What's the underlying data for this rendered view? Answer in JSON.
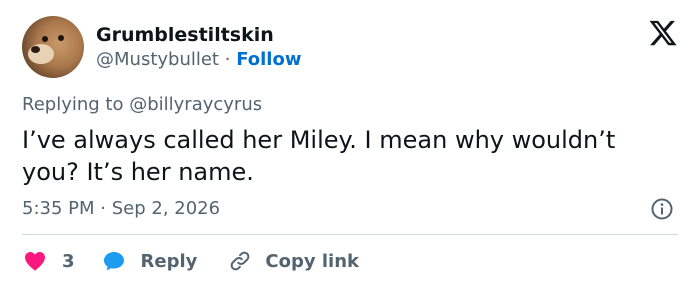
{
  "author": {
    "display_name": "Grumblestiltskin",
    "handle": "@Mustybullet",
    "separator": "·",
    "follow_label": "Follow"
  },
  "reply": {
    "prefix": "Replying to",
    "target": "@billyraycyrus"
  },
  "tweet": {
    "text": "I’ve always called her Miley. I mean why wouldn’t you? It’s her name.",
    "time": "5:35 PM",
    "separator": "·",
    "date": "Sep 2, 2026"
  },
  "actions": {
    "like_count": "3",
    "reply_label": "Reply",
    "copy_label": "Copy link"
  },
  "icons": {
    "logo": "x-logo-icon",
    "info": "info-icon",
    "like": "heart-icon",
    "reply": "speech-bubble-icon",
    "copy": "link-icon"
  },
  "colors": {
    "like": "#f91880",
    "reply": "#1d9bf0",
    "follow": "#0071cd",
    "muted": "#536471",
    "text": "#0f1419"
  }
}
